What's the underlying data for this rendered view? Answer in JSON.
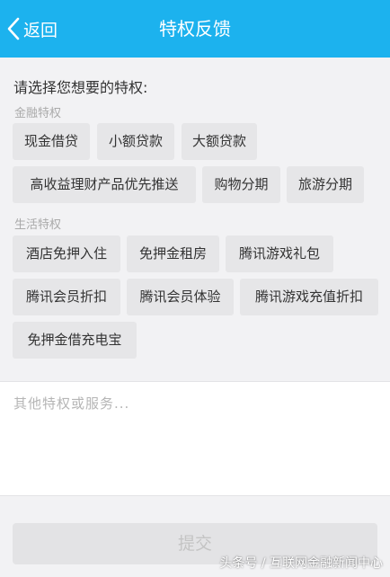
{
  "header": {
    "back_label": "返回",
    "title": "特权反馈"
  },
  "prompt": "请选择您想要的特权:",
  "sections": [
    {
      "label": "金融特权",
      "chips": [
        "现金借贷",
        "小额贷款",
        "大额贷款",
        "高收益理财产品优先推送",
        "购物分期",
        "旅游分期"
      ]
    },
    {
      "label": "生活特权",
      "chips": [
        "酒店免押入住",
        "免押金租房",
        "腾讯游戏礼包",
        "腾讯会员折扣",
        "腾讯会员体验",
        "腾讯游戏充值折扣",
        "免押金借充电宝"
      ]
    }
  ],
  "other_input": {
    "placeholder": "其他特权或服务...",
    "value": ""
  },
  "submit_label": "提交",
  "watermark": "头条号 / 互联网金融新闻中心",
  "colors": {
    "header_bg": "#1cb2ee",
    "chip_bg": "#e6e6e8",
    "page_bg": "#f2f2f4"
  }
}
